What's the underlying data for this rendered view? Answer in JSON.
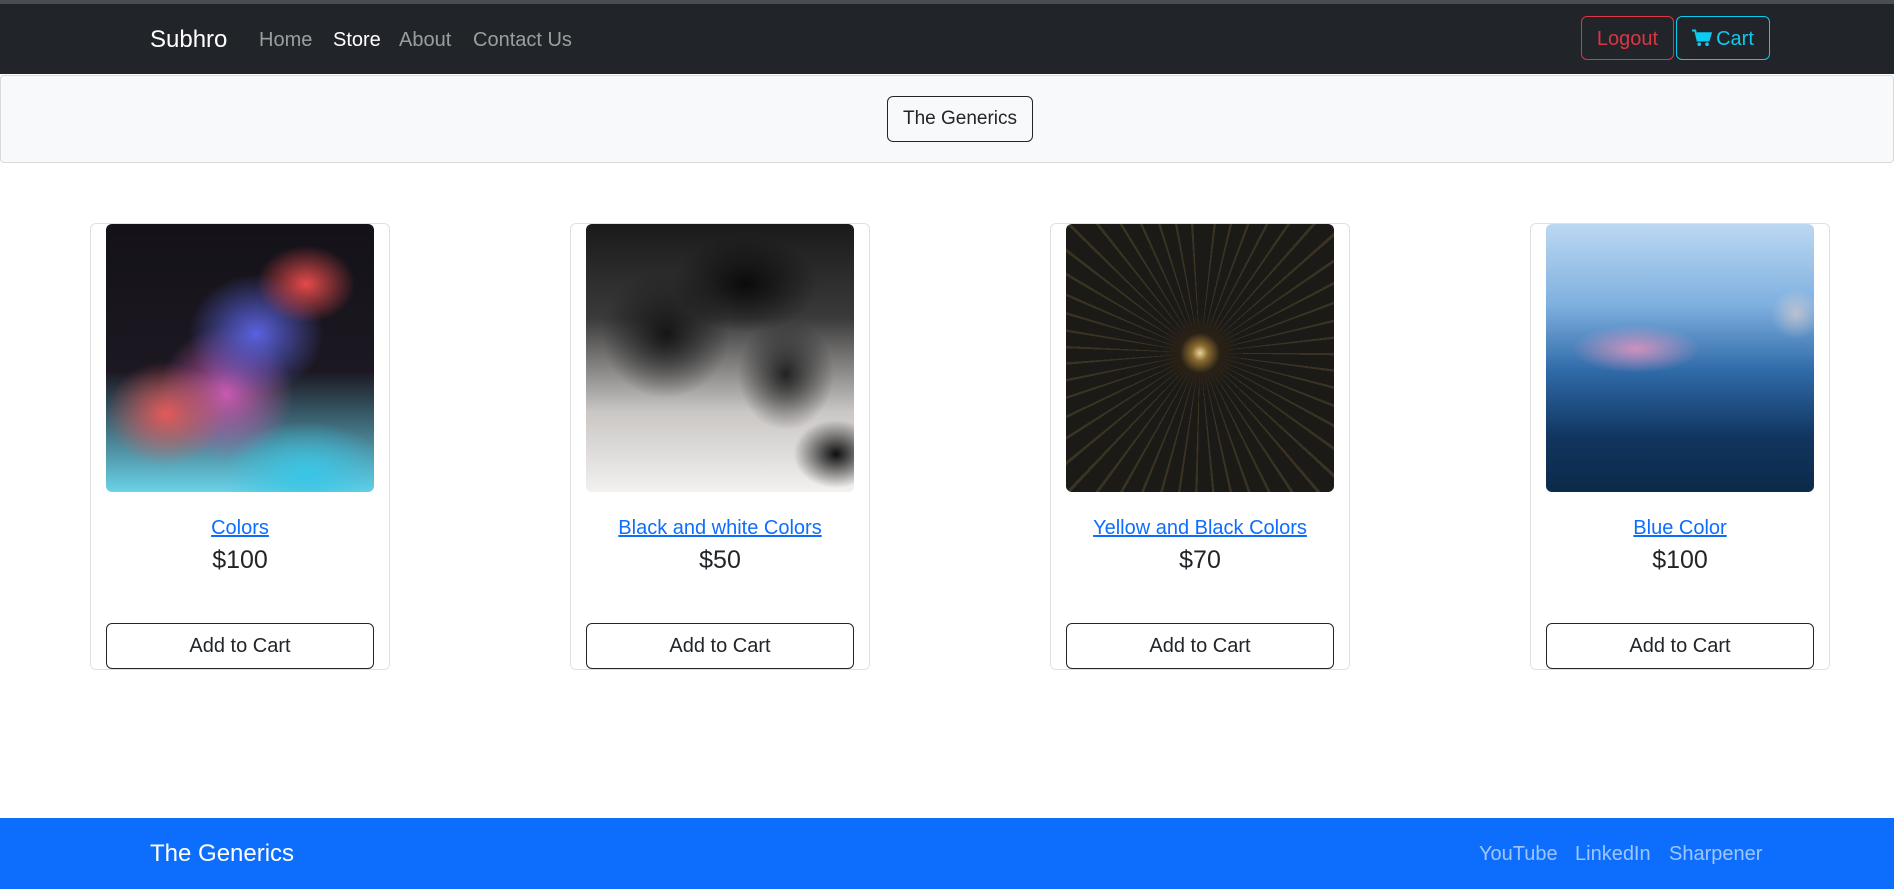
{
  "navbar": {
    "brand": "Subhro",
    "links": [
      "Home",
      "Store",
      "About",
      "Contact Us"
    ],
    "active_link": "Store",
    "logout_label": "Logout",
    "cart_label": "Cart",
    "logout_color": "#dc3545",
    "cart_color": "#0dcaf0"
  },
  "hero": {
    "button_label": "The Generics"
  },
  "products": [
    {
      "title": "Colors",
      "price": "$100",
      "button": "Add to Cart"
    },
    {
      "title": "Black and white Colors",
      "price": "$50",
      "button": "Add to Cart"
    },
    {
      "title": "Yellow and Black Colors",
      "price": "$70",
      "button": "Add to Cart"
    },
    {
      "title": "Blue Color",
      "price": "$100",
      "button": "Add to Cart"
    }
  ],
  "footer": {
    "brand": "The Generics",
    "links": [
      "YouTube",
      "LinkedIn",
      "Sharpener"
    ],
    "background": "#0d6efd"
  },
  "icons": {
    "cart": "cart-icon"
  }
}
